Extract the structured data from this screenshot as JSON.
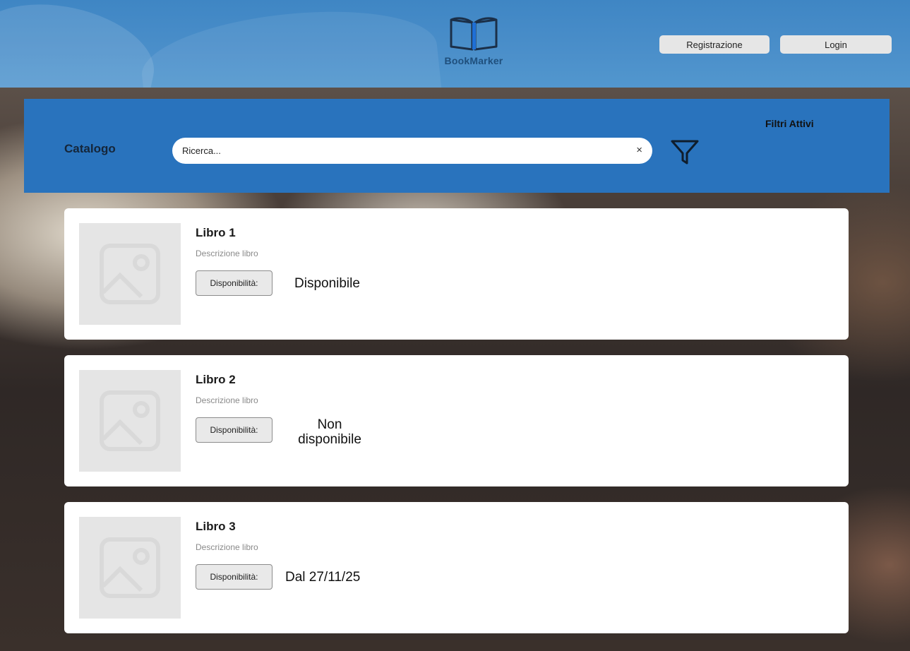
{
  "header": {
    "logo_text": "BookMarker",
    "register_label": "Registrazione",
    "login_label": "Login"
  },
  "catalog": {
    "title": "Catalogo",
    "search_placeholder": "Ricerca...",
    "clear_glyph": "×",
    "active_filters_label": "Filtri Attivi"
  },
  "books": [
    {
      "title": "Libro 1",
      "description": "Descrizione libro",
      "availability_label": "Disponibilità:",
      "availability_value": "Disponibile"
    },
    {
      "title": "Libro 2",
      "description": "Descrizione libro",
      "availability_label": "Disponibilità:",
      "availability_value_line1": "Non",
      "availability_value_line2": "disponibile"
    },
    {
      "title": "Libro 3",
      "description": "Descrizione libro",
      "availability_label": "Disponibilità:",
      "availability_value": "Dal 27/11/25"
    }
  ],
  "colors": {
    "header_blue": "#4b8fca",
    "catalog_bar_blue": "#2973bd",
    "logo_accent": "#1e6fd6"
  }
}
